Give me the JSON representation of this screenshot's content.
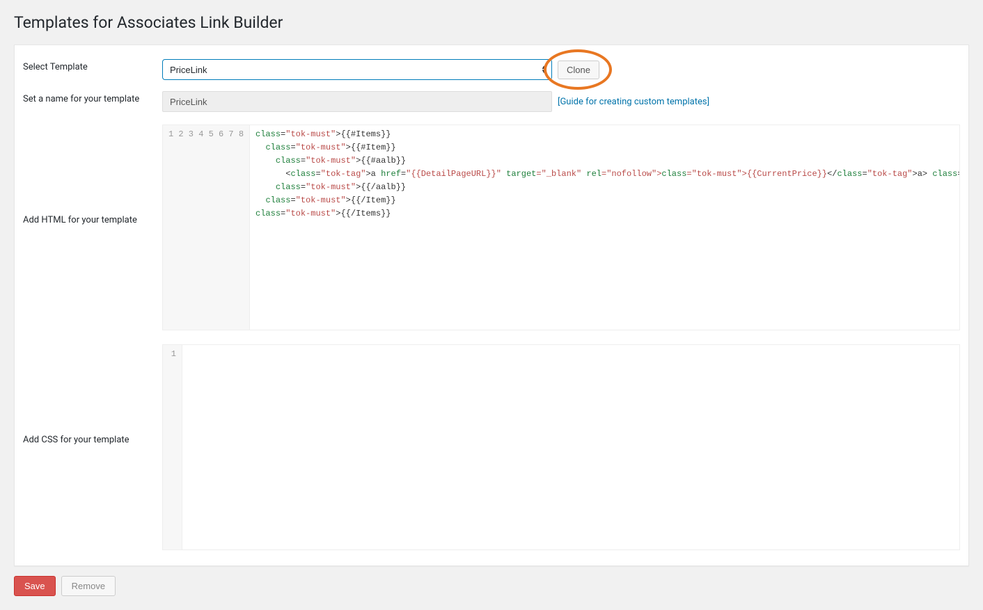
{
  "page": {
    "title": "Templates for Associates Link Builder"
  },
  "form": {
    "select_label": "Select Template",
    "select_value": "PriceLink",
    "clone_label": "Clone",
    "name_label": "Set a name for your template",
    "name_value": "PriceLink",
    "guide_link_text": "[Guide for creating custom templates]",
    "html_label": "Add HTML for your template",
    "css_label": "Add CSS for your template"
  },
  "html_editor": {
    "lines": [
      "{{#Items}}",
      "  {{#Item}}",
      "    {{#aalb}}",
      "      <a href=\"{{DetailPageURL}}\" target=\"_blank\" rel=\"nofollow\">{{CurrentPrice}}</a> <!--Individual attributes are provided as variable tags as",
      "    {{/aalb}}",
      "  {{/Item}}",
      "{{/Items}}",
      ""
    ]
  },
  "css_editor": {
    "lines": [
      ""
    ]
  },
  "actions": {
    "save_label": "Save",
    "remove_label": "Remove"
  }
}
